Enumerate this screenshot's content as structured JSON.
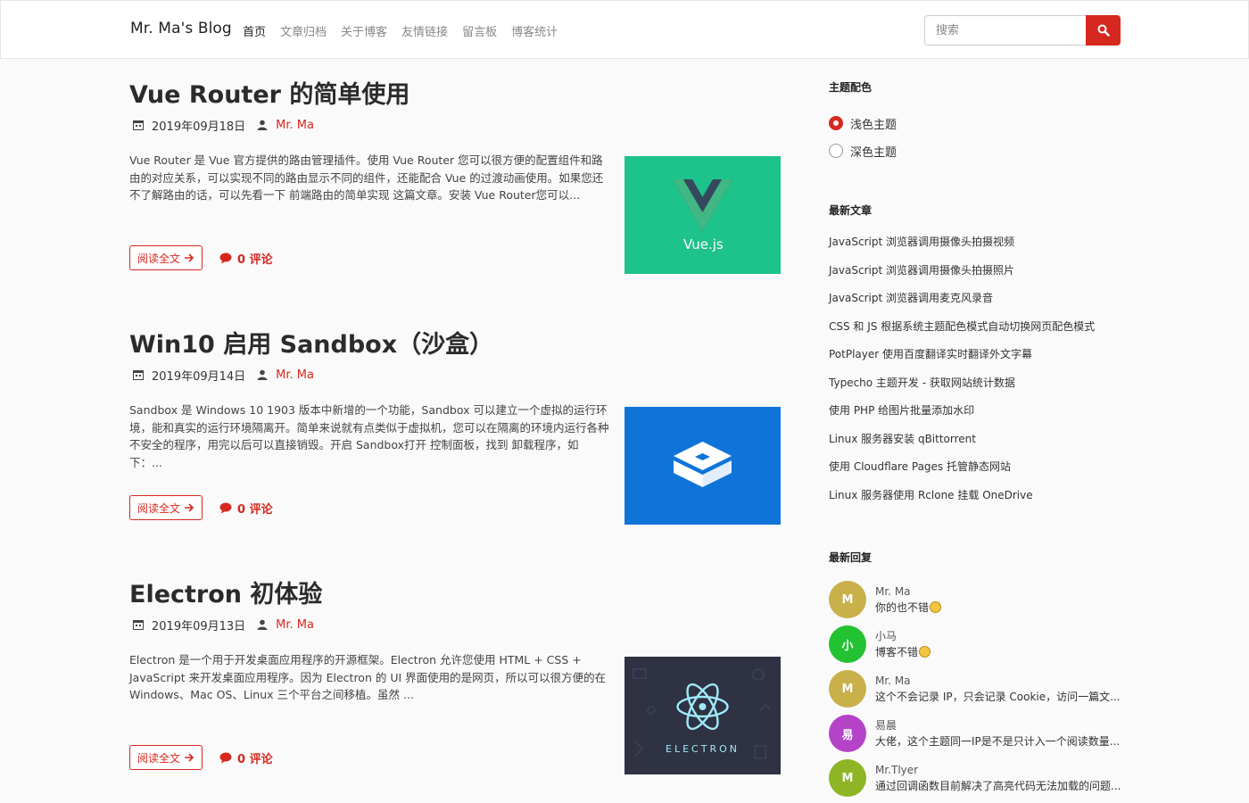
{
  "header": {
    "brand": "Mr. Ma's Blog",
    "nav": [
      "首页",
      "文章归档",
      "关于博客",
      "友情链接",
      "留言板",
      "博客统计"
    ],
    "search_placeholder": "搜索"
  },
  "posts": [
    {
      "title": "Vue Router 的简单使用",
      "date": "2019年09月18日",
      "author": "Mr. Ma",
      "excerpt": "Vue Router 是 Vue 官方提供的路由管理插件。使用 Vue Router 您可以很方便的配置组件和路由的对应关系，可以实现不同的路由显示不同的组件，还能配合 Vue 的过渡动画使用。如果您还不了解路由的话，可以先看一下 前端路由的简单实现 这篇文章。安装 Vue Router您可以...",
      "read_more": "阅读全文",
      "comments": "0 评论",
      "thumb_text": "Vue.js"
    },
    {
      "title": "Win10 启用 Sandbox（沙盒）",
      "date": "2019年09月14日",
      "author": "Mr. Ma",
      "excerpt": "Sandbox 是 Windows 10 1903 版本中新增的一个功能，Sandbox 可以建立一个虚拟的运行环境，能和真实的运行环境隔离开。简单来说就有点类似于虚拟机，您可以在隔离的环境内运行各种不安全的程序，用完以后可以直接销毁。开启 Sandbox打开 控制面板，找到 卸载程序，如下：...",
      "read_more": "阅读全文",
      "comments": "0 评论",
      "thumb_text": ""
    },
    {
      "title": "Electron 初体验",
      "date": "2019年09月13日",
      "author": "Mr. Ma",
      "excerpt": "Electron 是一个用于开发桌面应用程序的开源框架。Electron 允许您使用 HTML + CSS + JavaScript 来开发桌面应用程序。因为 Electron 的 UI 界面使用的是网页，所以可以很方便的在 Windows、Mac OS、Linux 三个平台之间移植。虽然 ...",
      "read_more": "阅读全文",
      "comments": "0 评论",
      "thumb_text": "ELECTRON"
    }
  ],
  "sidebar": {
    "theme_heading": "主题配色",
    "theme_options": [
      "浅色主题",
      "深色主题"
    ],
    "theme_selected": "浅色主题",
    "recent_heading": "最新文章",
    "recent_posts": [
      "JavaScript 浏览器调用摄像头拍摄视频",
      "JavaScript 浏览器调用摄像头拍摄照片",
      "JavaScript 浏览器调用麦克风录音",
      "CSS 和 JS 根据系统主题配色模式自动切换网页配色模式",
      "PotPlayer 使用百度翻译实时翻译外文字幕",
      "Typecho 主题开发 - 获取网站统计数据",
      "使用 PHP 给图片批量添加水印",
      "Linux 服务器安装 qBittorrent",
      "使用 Cloudflare Pages 托管静态网站",
      "Linux 服务器使用 Rclone 挂载 OneDrive"
    ],
    "replies_heading": "最新回复",
    "replies": [
      {
        "initial": "M",
        "name": "Mr. Ma",
        "message": "你的也不错",
        "emoji": true,
        "color": "#c9b04a"
      },
      {
        "initial": "小",
        "name": "小马",
        "message": "博客不错",
        "emoji": true,
        "color": "#22c232"
      },
      {
        "initial": "M",
        "name": "Mr. Ma",
        "message": "这个不会记录 IP，只会记录 Cookie，访问一篇文...",
        "emoji": false,
        "color": "#c9b04a"
      },
      {
        "initial": "易",
        "name": "易晨",
        "message": "大佬，这个主题同一IP是不是只计入一个阅读数量...",
        "emoji": false,
        "color": "#b443c8"
      },
      {
        "initial": "M",
        "name": "Mr.Tlyer",
        "message": "通过回调函数目前解决了高亮代码无法加载的问题...",
        "emoji": false,
        "color": "#8db526"
      }
    ]
  },
  "colors": {
    "accent": "#d6281e",
    "vue_bg": "#1ec28b",
    "sandbox_bg": "#0f74d8",
    "electron_bg": "#2f3242"
  }
}
